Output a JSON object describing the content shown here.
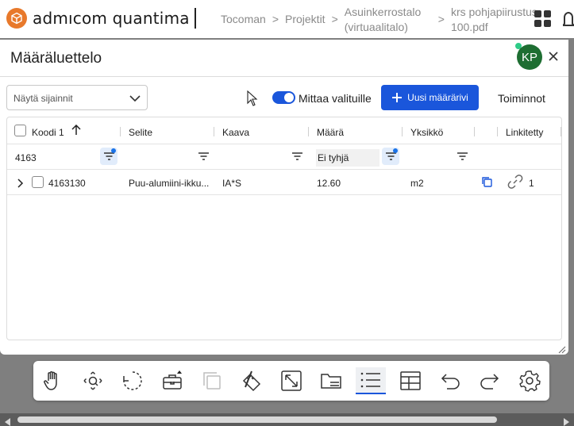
{
  "app": {
    "brand": "admıcom quantima",
    "breadcrumbs": [
      "Tocoman",
      "Projektit",
      "Asuinkerrostalo (virtuaalitalo)",
      "krs pohjapiirustus 100.pdf"
    ],
    "crumb_separator": ">"
  },
  "panel": {
    "title": "Määräluettelo",
    "avatar_initials": "KP",
    "location_select": "Näytä sijainnit",
    "measure_toggle_label": "Mittaa valituille",
    "measure_toggle_on": true,
    "new_button_label": "Uusi määrärivi",
    "actions_label": "Toiminnot"
  },
  "table": {
    "columns": [
      "Koodi 1",
      "Selite",
      "Kaava",
      "Määrä",
      "Yksikkö",
      "",
      "Linkitetty"
    ],
    "filters": {
      "code": "4163",
      "description": "",
      "formula": "",
      "quantity": "Ei tyhjä",
      "unit": ""
    },
    "rows": [
      {
        "code": "4163130",
        "description": "Puu-alumiini-ikku...",
        "formula": "IA*S",
        "quantity": "12.60",
        "unit": "m2",
        "linked": "1"
      }
    ]
  },
  "toolbar": {
    "tools": [
      "pan-hand",
      "zoom-search",
      "rotate",
      "toolbox",
      "layers-copy",
      "measure-pencil",
      "fit-expand",
      "folder",
      "list",
      "table",
      "undo",
      "redo",
      "settings"
    ],
    "active_tool": "list"
  },
  "colors": {
    "accent": "#1a56db",
    "brand_orange": "#e8792b",
    "avatar_green": "#1e6e32",
    "status_dot": "#2ecc88"
  }
}
